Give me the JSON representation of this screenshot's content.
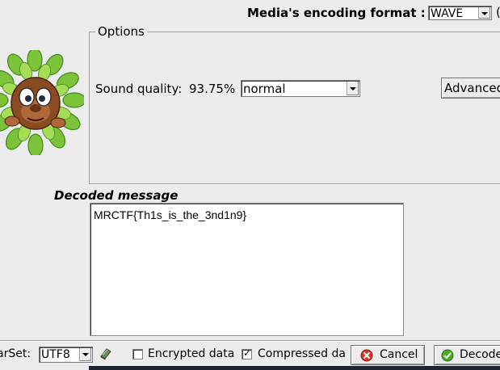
{
  "header": {
    "format_label": "Media's encoding format :",
    "format_value": "WAVE",
    "edge_glyph": "("
  },
  "options": {
    "title": "Options",
    "sound_quality_label": "Sound quality:",
    "sound_quality_percent": "93.75%",
    "sound_quality_value": "normal",
    "advanced_label": "Advanced"
  },
  "decoded": {
    "title": "Decoded message",
    "text": "MRCTF{Th1s_is_the_3nd1n9}"
  },
  "footer": {
    "charset_label": "arSet:",
    "charset_value": "UTF8",
    "encrypted_label": "Encrypted data",
    "encrypted_checked": false,
    "compressed_label": "Compressed dat",
    "compressed_checked": true,
    "checkmark": "✓",
    "cancel_label": "Cancel",
    "decode_label": "Decode"
  },
  "icons": {
    "mascot": "mascot-in-leaves-icon",
    "charset_book": "book-icon",
    "cancel": "cancel-x-icon",
    "decode": "checkmark-icon"
  },
  "colors": {
    "background": "#ececec",
    "leaf_green": "#7cc33a",
    "cancel_red": "#d23a2a",
    "decode_green": "#4caa2a"
  }
}
